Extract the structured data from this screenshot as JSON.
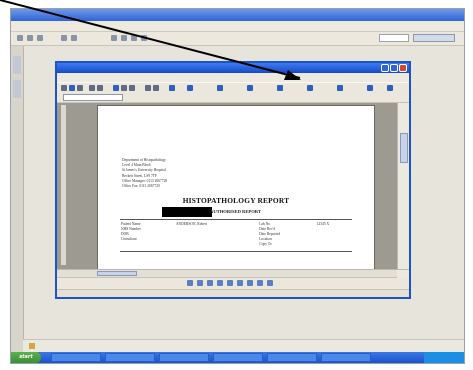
{
  "outer": {
    "title": "",
    "menu": [],
    "search_button": ""
  },
  "app": {
    "title": "",
    "menu": [],
    "style_value": "",
    "draw_label": ""
  },
  "document": {
    "address_lines": [
      "Department of Histopathology",
      "Level 4 Main Block",
      "St James's University Hospital",
      "Beckett Street, LS9 7TF",
      "Office Manager: 0113 2067728",
      "Office Fax: 0113 2067720"
    ],
    "report_title": "HISTOPATHOLOGY REPORT",
    "report_subtitle": "AUTHORISED REPORT",
    "info_rows": [
      [
        "Patient Name",
        "ANDERSON, Robert",
        "Lab No.",
        "12345 X"
      ],
      [
        "NHS Number",
        "",
        "Date Rec'd",
        ""
      ],
      [
        "DOB",
        "",
        "Date Reported",
        ""
      ],
      [
        "Consultant",
        "",
        "Location",
        ""
      ],
      [
        "",
        "",
        "Copy To",
        ""
      ]
    ]
  },
  "outer_status": {
    "text": ""
  },
  "taskbar": {
    "start_label": "start",
    "items": [
      "",
      "",
      "",
      "",
      "",
      ""
    ],
    "clock": ""
  },
  "colors": {
    "accent": "#1c54c7",
    "arrow": "#000000"
  }
}
